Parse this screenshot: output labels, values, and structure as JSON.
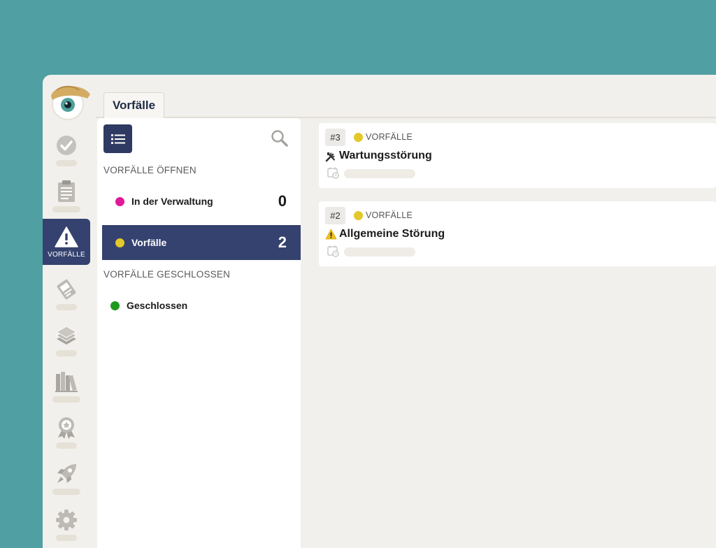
{
  "colors": {
    "frame": "#509fa3",
    "window": "#f2f0ec",
    "active_nav": "#35426f",
    "status_admin": "#e0199b",
    "status_incident": "#e3c829",
    "status_closed": "#1d9a1d"
  },
  "sidebar": {
    "items": [
      {
        "icon": "check-circle-icon",
        "label": ""
      },
      {
        "icon": "clipboard-icon",
        "label": ""
      },
      {
        "icon": "warning-icon",
        "label": "VORFÄLLE",
        "active": true
      },
      {
        "icon": "ticket-icon",
        "label": ""
      },
      {
        "icon": "stack-icon",
        "label": ""
      },
      {
        "icon": "books-icon",
        "label": ""
      },
      {
        "icon": "award-icon",
        "label": ""
      },
      {
        "icon": "rocket-icon",
        "label": ""
      },
      {
        "icon": "gear-icon",
        "label": ""
      }
    ]
  },
  "tab": {
    "label": "Vorfälle"
  },
  "panel": {
    "open_section": "VORFÄLLE ÖFFNEN",
    "closed_section": "VORFÄLLE GESCHLOSSEN",
    "rows": [
      {
        "name": "In der Verwaltung",
        "count": "0"
      },
      {
        "name": "Vorfälle",
        "count": "2"
      },
      {
        "name": "Geschlossen",
        "count": ""
      }
    ]
  },
  "cards": [
    {
      "number": "#3",
      "status": "VORFÄLLE",
      "icon": "tools-icon",
      "title": "Wartungsstörung"
    },
    {
      "number": "#2",
      "status": "VORFÄLLE",
      "icon": "warning-icon",
      "title": "Allgemeine Störung"
    }
  ]
}
